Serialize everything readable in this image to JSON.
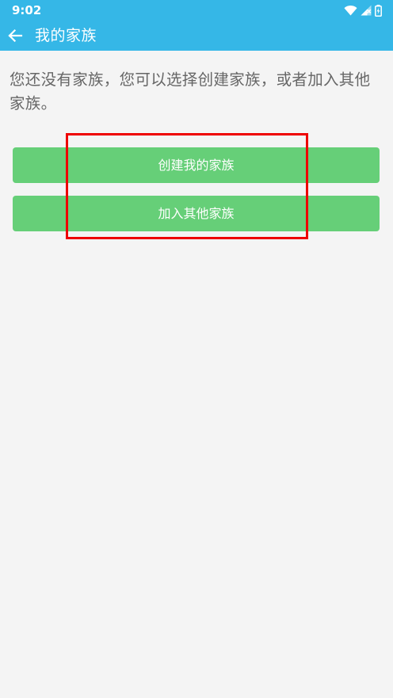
{
  "status_bar": {
    "time": "9:02",
    "icons": [
      "wifi-icon",
      "signal-icon",
      "battery-icon"
    ],
    "bg_color": "#35b7e7"
  },
  "toolbar": {
    "title": "我的家族",
    "back_icon": "arrow-left-icon",
    "bg_color": "#35b7e7"
  },
  "main": {
    "message": "您还没有家族，您可以选择创建家族，或者加入其他家族。",
    "buttons": [
      {
        "label": "创建我的家族"
      },
      {
        "label": "加入其他家族"
      }
    ],
    "button_color": "#66cf78",
    "highlight_color": "#ee0000"
  }
}
